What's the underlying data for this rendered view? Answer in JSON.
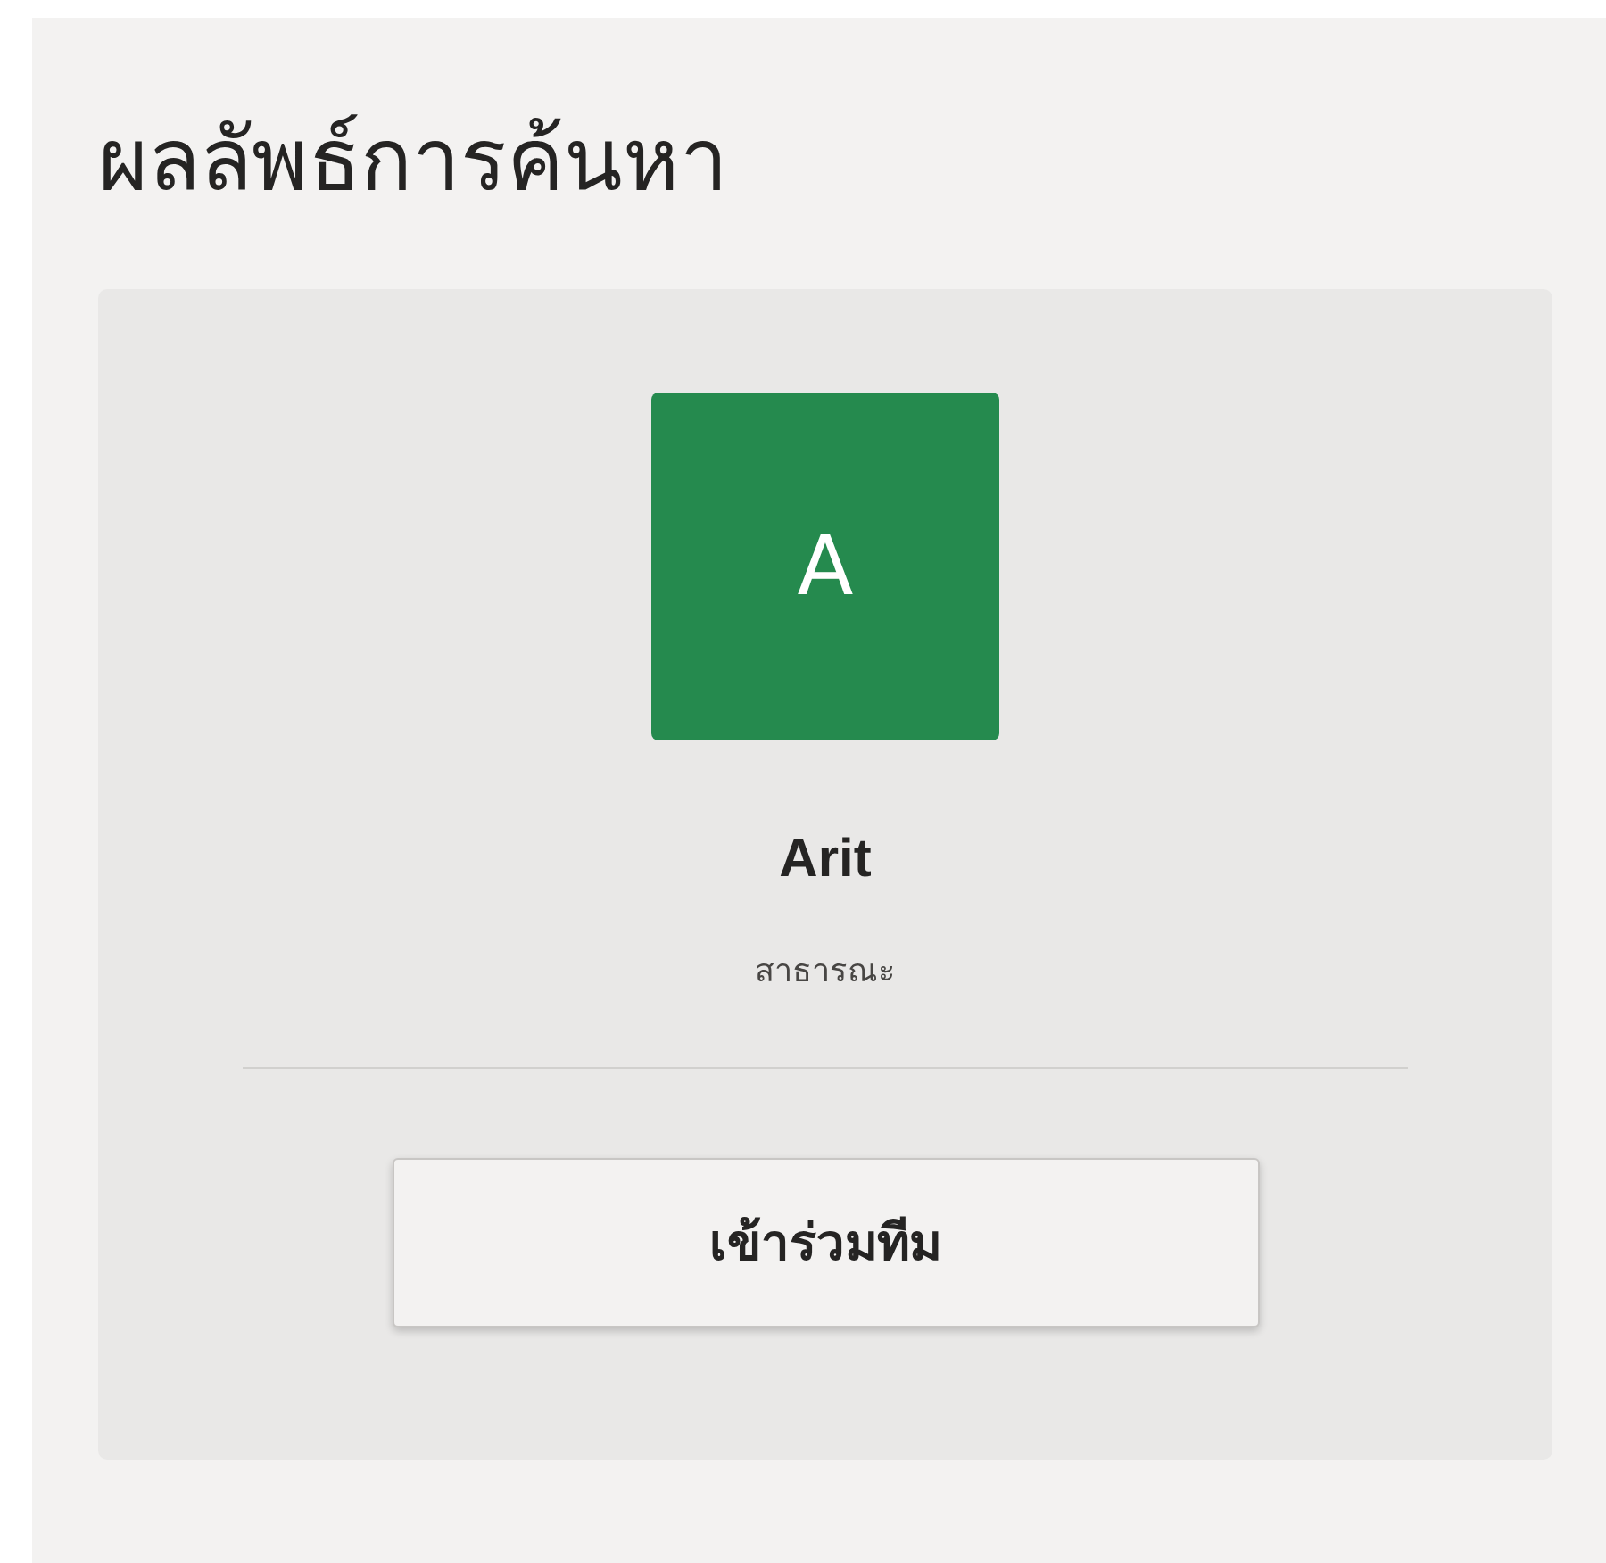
{
  "title": "ผลลัพธ์การค้นหา",
  "result": {
    "avatar_letter": "A",
    "name": "Arit",
    "visibility": "สาธารณะ",
    "join_button": "เข้าร่วมทีม"
  }
}
